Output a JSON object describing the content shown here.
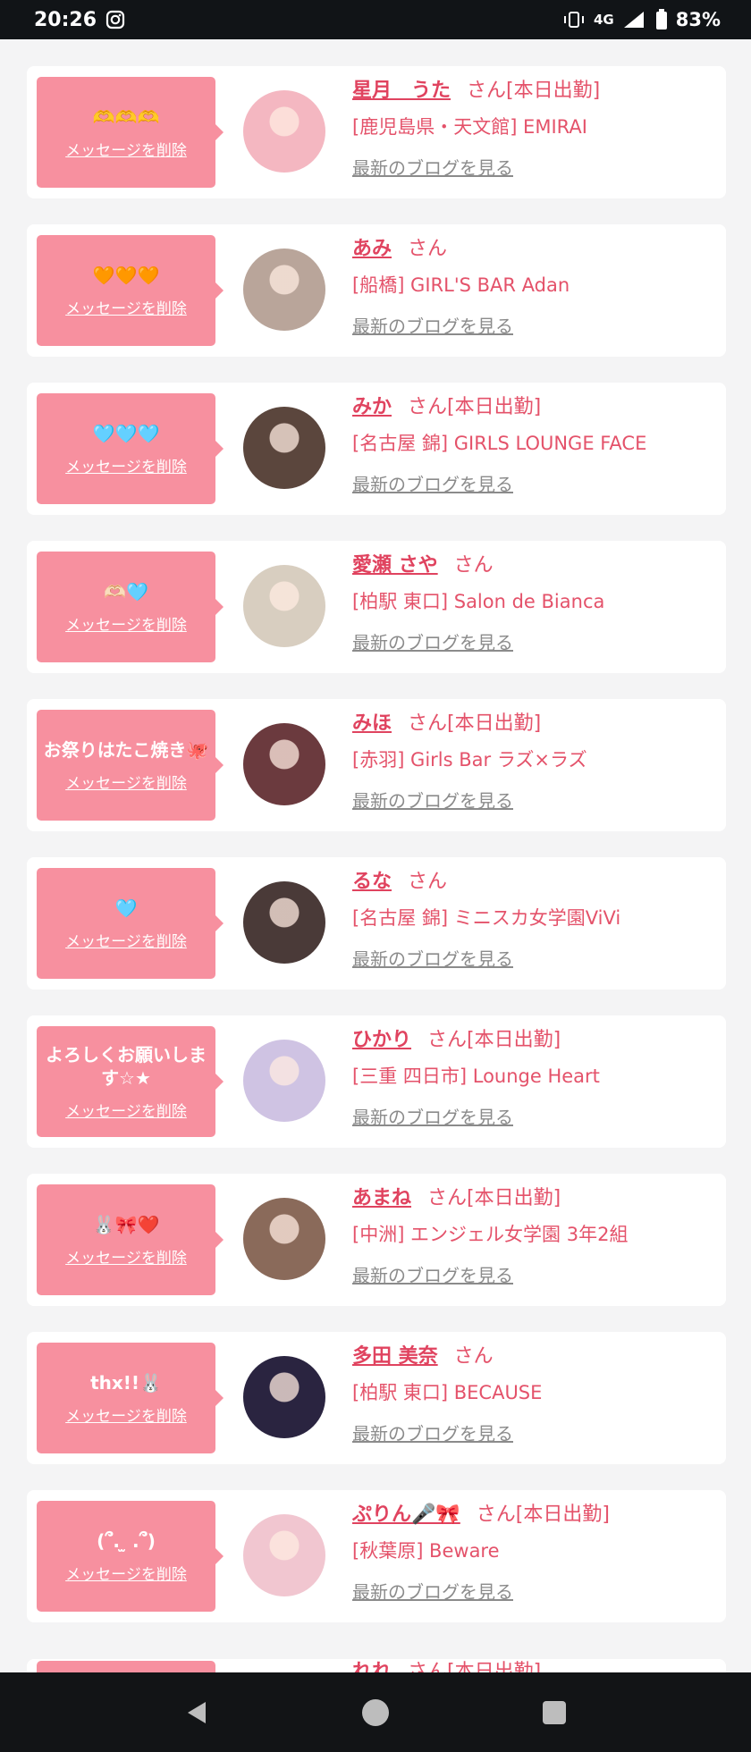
{
  "status_bar": {
    "time": "20:26",
    "network": "4G",
    "battery": "83%"
  },
  "cards": [
    {
      "message": "🫶🫶🫶",
      "delete_label": "メッセージを削除",
      "name": "星月　うた",
      "suffix": "さん[本日出勤]",
      "place": "[鹿児島県・天文館] EMIRAI",
      "blog_label": "最新のブログを見る",
      "avatar_color": "#f4b7c1"
    },
    {
      "message": "🧡🧡🧡",
      "delete_label": "メッセージを削除",
      "name": "あみ",
      "suffix": "さん",
      "place": "[船橋] GIRL'S BAR Adan",
      "blog_label": "最新のブログを見る",
      "avatar_color": "#b9a59a"
    },
    {
      "message": "🩵🩵🩵",
      "delete_label": "メッセージを削除",
      "name": "みか",
      "suffix": "さん[本日出勤]",
      "place": "[名古屋 錦] GIRLS LOUNGE FACE",
      "blog_label": "最新のブログを見る",
      "avatar_color": "#5b463d"
    },
    {
      "message": "🫶🏻🩵",
      "delete_label": "メッセージを削除",
      "name": "愛瀬 さや",
      "suffix": "さん",
      "place": "[柏駅 東口] Salon de Bianca",
      "blog_label": "最新のブログを見る",
      "avatar_color": "#d8cec0"
    },
    {
      "message": "お祭りはたこ焼き🐙",
      "delete_label": "メッセージを削除",
      "name": "みほ",
      "suffix": "さん[本日出勤]",
      "place": "[赤羽] Girls Bar ラズ×ラズ",
      "blog_label": "最新のブログを見る",
      "avatar_color": "#6b3a3e"
    },
    {
      "message": "🩵",
      "delete_label": "メッセージを削除",
      "name": "るな",
      "suffix": "さん",
      "place": "[名古屋 錦] ミニスカ女学園ViVi",
      "blog_label": "最新のブログを見る",
      "avatar_color": "#4a3a38"
    },
    {
      "message": "よろしくお願いします☆★",
      "delete_label": "メッセージを削除",
      "name": "ひかり",
      "suffix": "さん[本日出勤]",
      "place": "[三重 四日市] Lounge Heart",
      "blog_label": "最新のブログを見る",
      "avatar_color": "#cfc3e3"
    },
    {
      "message": "🐰🎀❤️",
      "delete_label": "メッセージを削除",
      "name": "あまね",
      "suffix": "さん[本日出勤]",
      "place": "[中洲] エンジェル女学園 3年2組",
      "blog_label": "最新のブログを見る",
      "avatar_color": "#8a6a5a"
    },
    {
      "message": "thx!!🐰",
      "delete_label": "メッセージを削除",
      "name": "多田 美奈",
      "suffix": "さん",
      "place": "[柏駅 東口] BECAUSE",
      "blog_label": "最新のブログを見る",
      "avatar_color": "#2a2440"
    },
    {
      "message": "(՞. ̫ .՞)",
      "delete_label": "メッセージを削除",
      "name": "ぷりん🎤🎀",
      "suffix": "さん[本日出勤]",
      "place": "[秋葉原] Beware",
      "blog_label": "最新のブログを見る",
      "avatar_color": "#f1c6d0"
    }
  ],
  "partial_card": {
    "name": "れれ",
    "suffix": "さん[本日出勤]"
  }
}
